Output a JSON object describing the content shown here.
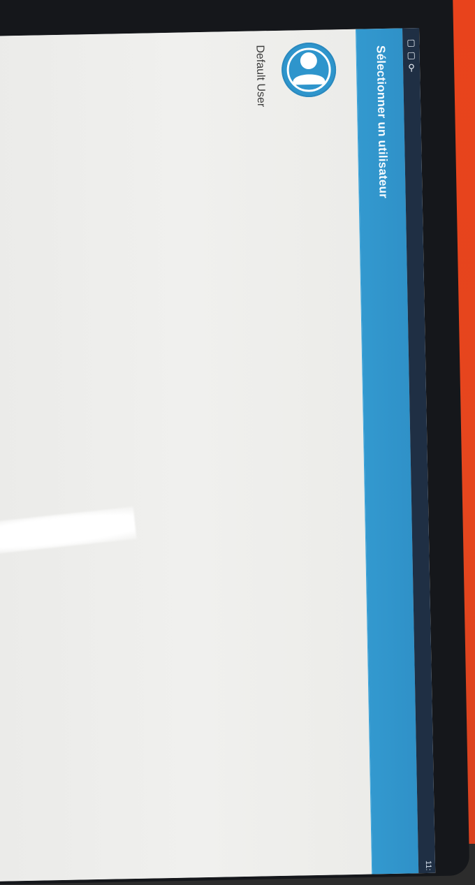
{
  "status_bar": {
    "icons": [
      "photo-icon",
      "photo-icon",
      "usb-icon"
    ],
    "time": "11:"
  },
  "action_bar": {
    "title": "Sélectionner un utilisateur"
  },
  "users": [
    {
      "name": "Default User",
      "icon": "user-avatar-icon"
    }
  ],
  "colors": {
    "action_bar": "#2f91c8",
    "status_bar": "#1f2f44",
    "background": "#ededeb",
    "avatar": "#2e95cc"
  }
}
